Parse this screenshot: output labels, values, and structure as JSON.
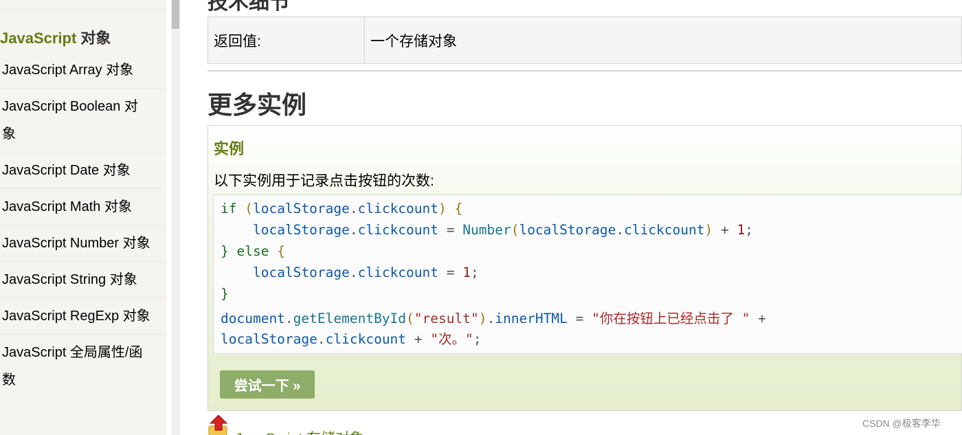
{
  "sidebar": {
    "heading_en": "JavaScript",
    "heading_zh": " 对象",
    "items": [
      {
        "label": "JavaScript Array 对象"
      },
      {
        "label": "JavaScript Boolean 对象"
      },
      {
        "label": "JavaScript Date 对象"
      },
      {
        "label": "JavaScript Math 对象"
      },
      {
        "label": "JavaScript Number 对象"
      },
      {
        "label": "JavaScript String 对象"
      },
      {
        "label": "JavaScript RegExp 对象"
      },
      {
        "label": "JavaScript 全局属性/函数"
      }
    ]
  },
  "main": {
    "cut_heading": "技术细节",
    "return_table": {
      "label": "返回值:",
      "value": "一个存储对象"
    },
    "section_title": "更多实例",
    "example": {
      "title": "实例",
      "description": "以下实例用于记录点击按钮的次数:",
      "code": {
        "l1_if": "if",
        "l1_paren_open": " (",
        "l1_obj": "localStorage",
        "l1_dot": ".",
        "l1_prop": "clickcount",
        "l1_close": ") {",
        "l2_indent": "    ",
        "l2_obj": "localStorage",
        "l2_dot": ".",
        "l2_prop": "clickcount",
        "l2_eq": " = ",
        "l2_fn": "Number",
        "l2_po": "(",
        "l2_obj2": "localStorage",
        "l2_dot2": ".",
        "l2_prop2": "clickcount",
        "l2_pc": ")",
        "l2_plus": " + ",
        "l2_num": "1",
        "l2_semi": ";",
        "l3_brace": "}",
        "l3_else": " else",
        "l3_open": " {",
        "l4_indent": "    ",
        "l4_obj": "localStorage",
        "l4_dot": ".",
        "l4_prop": "clickcount",
        "l4_eq": " = ",
        "l4_num": "1",
        "l4_semi": ";",
        "l5_brace": "}",
        "l6_doc": "document",
        "l6_dot": ".",
        "l6_fn": "getElementById",
        "l6_po": "(",
        "l6_str": "\"result\"",
        "l6_pc": ")",
        "l6_dot2": ".",
        "l6_prop": "innerHTML",
        "l6_eq": " = ",
        "l6_str2": "\"你在按钮上已经点击了 \"",
        "l6_plus": " +",
        "l7_obj": "localStorage",
        "l7_dot": ".",
        "l7_prop": "clickcount",
        "l7_plus": " + ",
        "l7_str": "\"次。\"",
        "l7_semi": ";"
      },
      "try_button_label": "尝试一下 »"
    },
    "back_link_label": "JavaScript 存储对象"
  },
  "watermark": "CSDN @极客李华",
  "colors": {
    "accent_green": "#617f10",
    "button_green": "#8ead68"
  }
}
